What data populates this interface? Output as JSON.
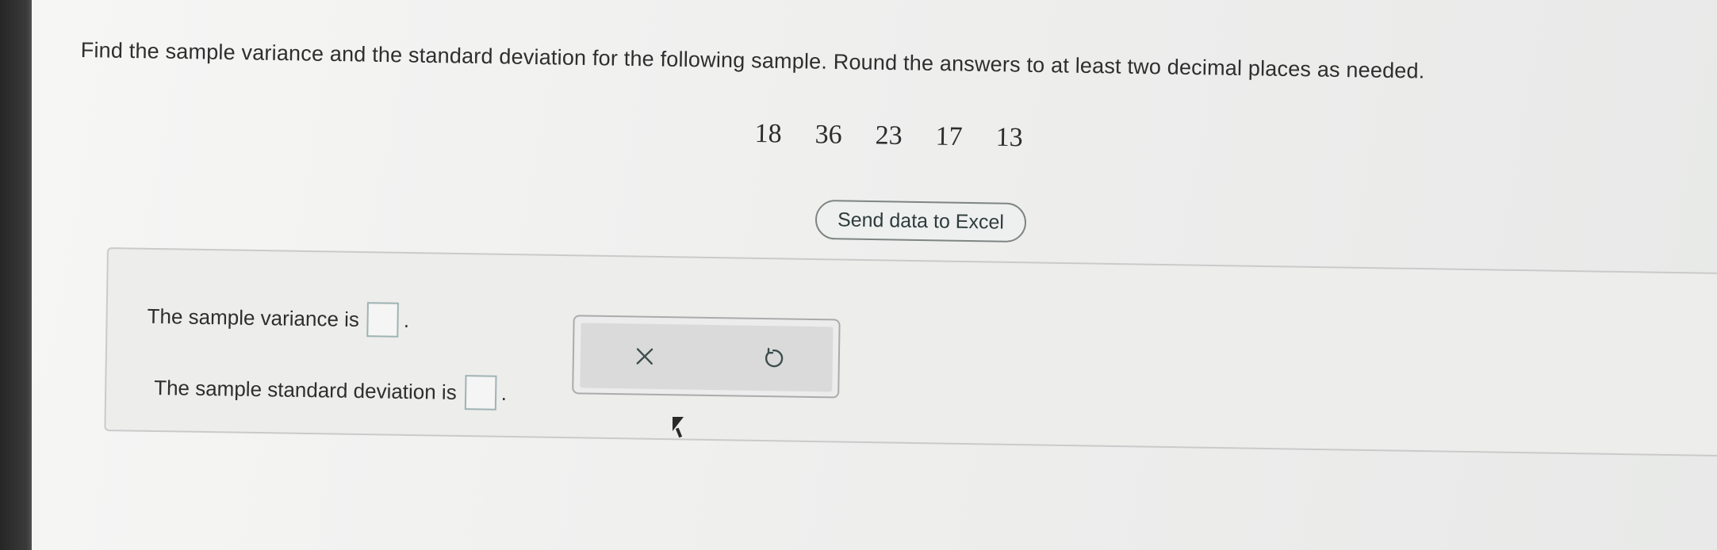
{
  "question": {
    "prompt": "Find the sample variance and the standard deviation for the following sample. Round the answers to at least two decimal places as needed."
  },
  "sample": {
    "values": [
      "18",
      "36",
      "23",
      "17",
      "13"
    ]
  },
  "toolbar": {
    "send_label": "Send data to Excel"
  },
  "answers": {
    "variance_label": "The sample variance is",
    "sd_label": "The sample standard deviation is",
    "period": "."
  },
  "icons": {
    "clear": "close-icon",
    "undo": "undo-icon"
  }
}
